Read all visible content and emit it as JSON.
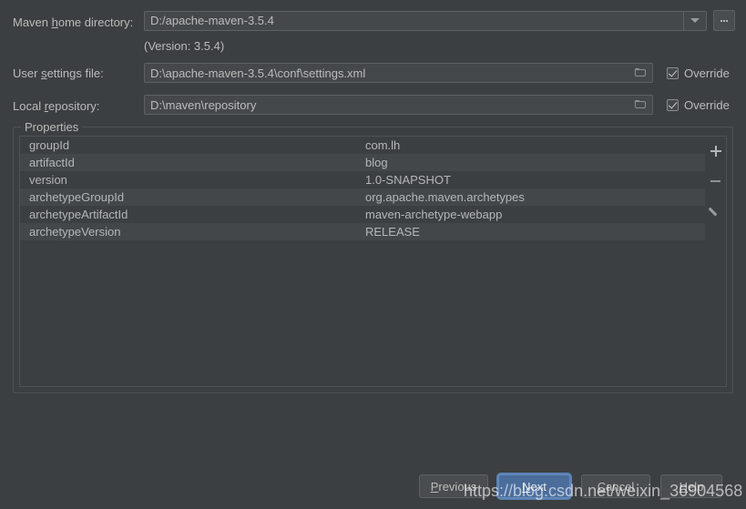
{
  "fields": {
    "maven_home": {
      "label_pre": "Maven ",
      "label_mnemonic": "h",
      "label_post": "ome directory:",
      "value": "D:/apache-maven-3.5.4",
      "version_note": "(Version: 3.5.4)",
      "dropdown_icon": "chevron-down-icon",
      "browse_label": "..."
    },
    "user_settings": {
      "label_pre": "User ",
      "label_mnemonic": "s",
      "label_post": "ettings file:",
      "value": "D:\\apache-maven-3.5.4\\conf\\settings.xml",
      "browse_icon": "folder-icon",
      "override_label": "Override",
      "override_checked": true
    },
    "local_repository": {
      "label_pre": "Local ",
      "label_mnemonic": "r",
      "label_post": "epository:",
      "value": "D:\\maven\\repository",
      "browse_icon": "folder-icon",
      "override_label": "Override",
      "override_checked": true
    }
  },
  "properties": {
    "group_title": "Properties",
    "rows": [
      {
        "key": "groupId",
        "value": "com.lh"
      },
      {
        "key": "artifactId",
        "value": "blog"
      },
      {
        "key": "version",
        "value": "1.0-SNAPSHOT"
      },
      {
        "key": "archetypeGroupId",
        "value": "org.apache.maven.archetypes"
      },
      {
        "key": "archetypeArtifactId",
        "value": "maven-archetype-webapp"
      },
      {
        "key": "archetypeVersion",
        "value": "RELEASE"
      }
    ],
    "tools": [
      {
        "name": "add-property-button",
        "icon": "plus-icon"
      },
      {
        "name": "remove-property-button",
        "icon": "minus-icon"
      },
      {
        "name": "edit-property-button",
        "icon": "pencil-icon"
      }
    ]
  },
  "buttons": {
    "previous": {
      "pre": "",
      "mnemonic": "P",
      "post": "revious"
    },
    "next": {
      "pre": "",
      "mnemonic": "N",
      "post": "ext"
    },
    "cancel": {
      "pre": "",
      "mnemonic": "C",
      "post": "ancel"
    },
    "help": {
      "pre": "",
      "mnemonic": "H",
      "post": "elp"
    }
  },
  "watermark": "https://blog.csdn.net/weixin_36904568",
  "colors": {
    "background": "#3c3f41",
    "field": "#45484a",
    "text": "#bbbbbb",
    "accent": "#4a6d9b",
    "row_alt": "#434749"
  }
}
